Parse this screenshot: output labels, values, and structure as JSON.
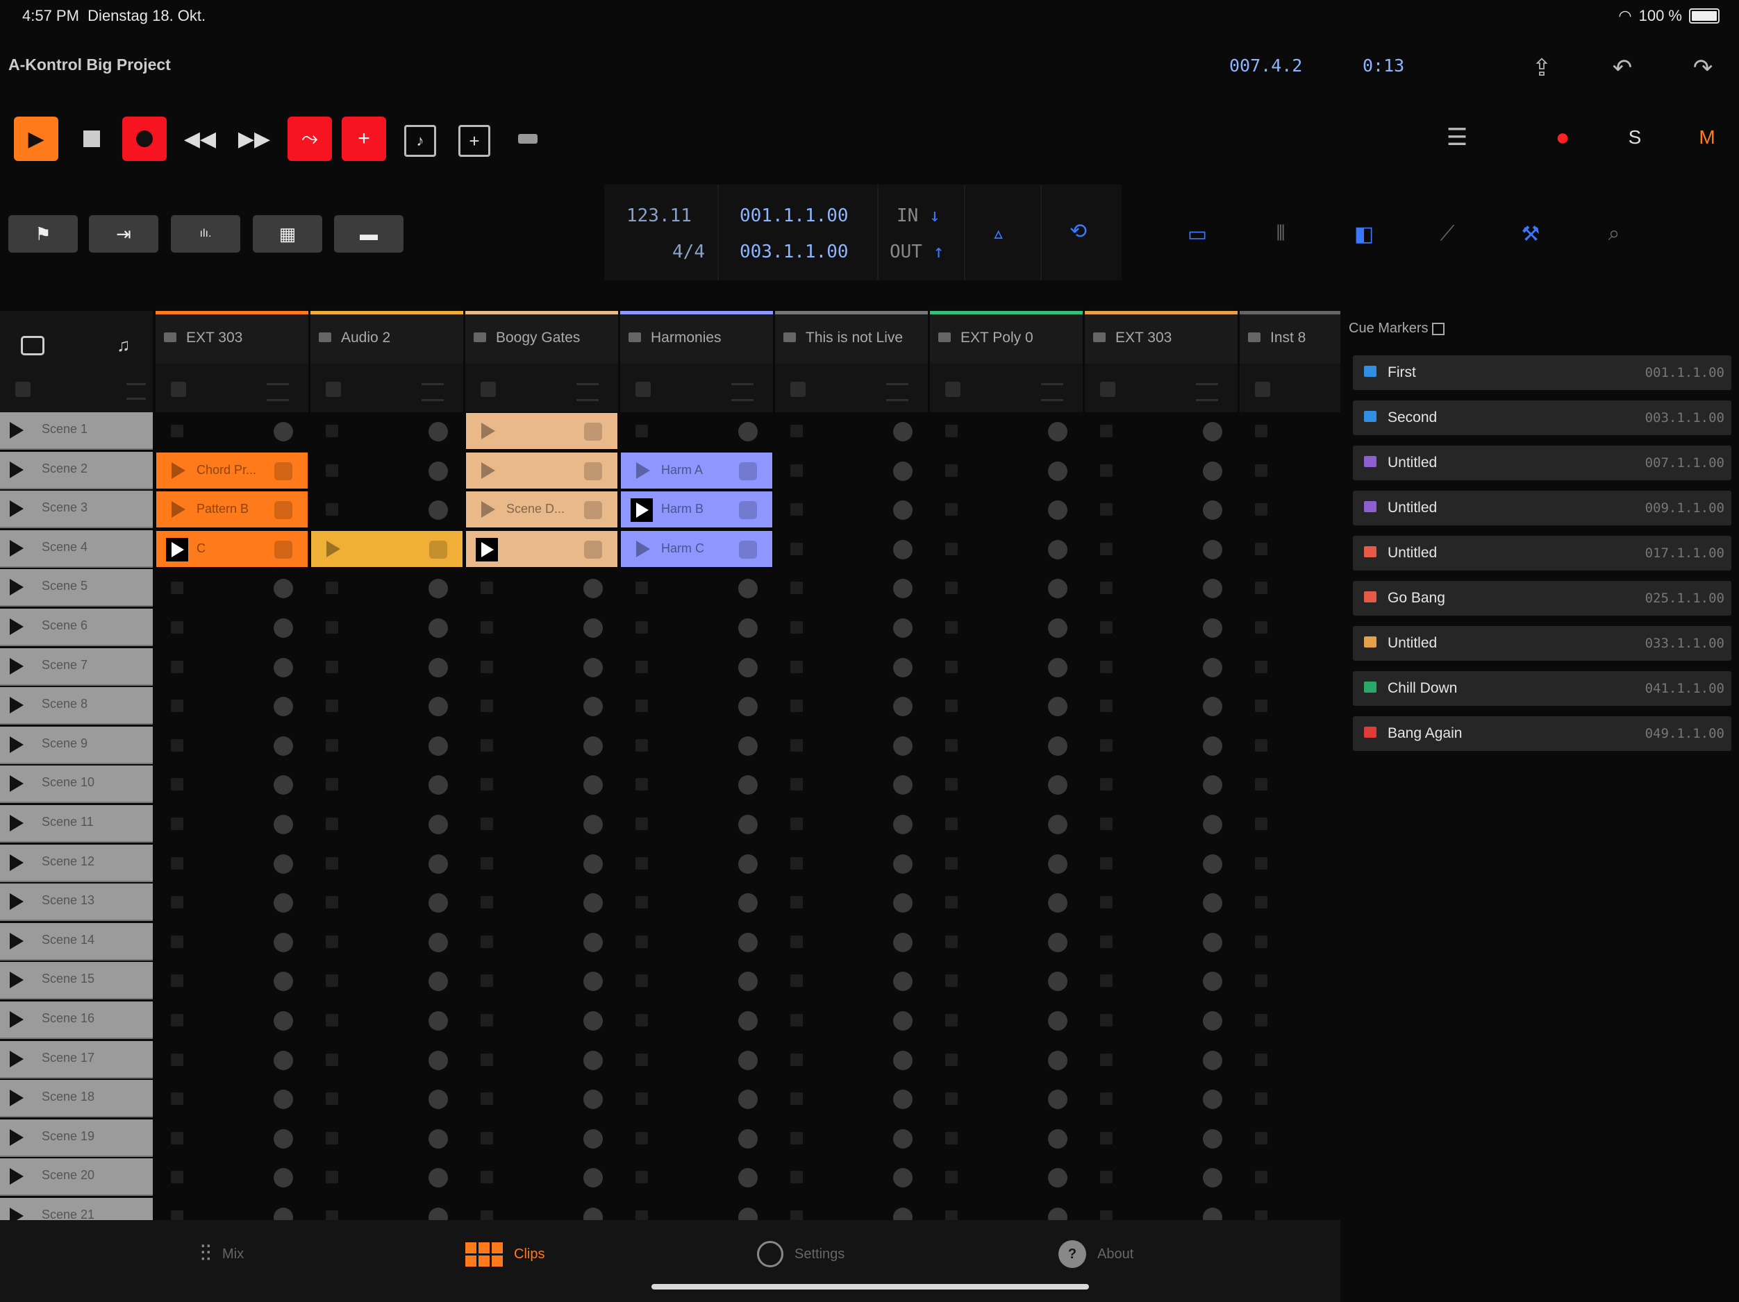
{
  "status": {
    "time": "4:57 PM",
    "date": "Dienstag 18. Okt.",
    "battery": "100 %"
  },
  "project": {
    "title": "A-Kontrol Big Project",
    "position": "007.4.2",
    "clock": "0:13"
  },
  "lcd": {
    "tempo": "123.11",
    "signature": "4/4",
    "loop_start": "001.1.1.00",
    "loop_end": "003.1.1.00",
    "in_label": "IN",
    "out_label": "OUT"
  },
  "tracks": [
    {
      "name": "EXT 303",
      "color": "#ff7a1a"
    },
    {
      "name": "Audio 2",
      "color": "#f0b037"
    },
    {
      "name": "Boogy Gates",
      "color": "#e9b98a"
    },
    {
      "name": "Harmonies",
      "color": "#8d97ff"
    },
    {
      "name": "This is not Live",
      "color": "#777777"
    },
    {
      "name": "EXT Poly 0",
      "color": "#36c07a"
    },
    {
      "name": "EXT 303",
      "color": "#e5a24a"
    },
    {
      "name": "Inst 8",
      "color": "#666666"
    }
  ],
  "scenes": [
    "Scene 1",
    "Scene 2",
    "Scene 3",
    "Scene 4",
    "Scene 5",
    "Scene 6",
    "Scene 7",
    "Scene 8",
    "Scene 9",
    "Scene 10",
    "Scene 11",
    "Scene 12",
    "Scene 13",
    "Scene 14",
    "Scene 15",
    "Scene 16",
    "Scene 17",
    "Scene 18",
    "Scene 19",
    "Scene 20",
    "Scene 21"
  ],
  "clips": [
    {
      "track": 2,
      "scene": 0,
      "name": "",
      "color": "#e9b98a",
      "playing": false
    },
    {
      "track": 0,
      "scene": 1,
      "name": "Chord Pr...",
      "color": "#ff7a1a",
      "playing": false
    },
    {
      "track": 2,
      "scene": 1,
      "name": "",
      "color": "#e9b98a",
      "playing": false
    },
    {
      "track": 3,
      "scene": 1,
      "name": "Harm A",
      "color": "#8d97ff",
      "playing": false
    },
    {
      "track": 0,
      "scene": 2,
      "name": "Pattern B",
      "color": "#ff7a1a",
      "playing": false
    },
    {
      "track": 2,
      "scene": 2,
      "name": "Scene D...",
      "color": "#e9b98a",
      "playing": false
    },
    {
      "track": 3,
      "scene": 2,
      "name": "Harm B",
      "color": "#8d97ff",
      "playing": true
    },
    {
      "track": 0,
      "scene": 3,
      "name": "C",
      "color": "#ff7a1a",
      "playing": true
    },
    {
      "track": 1,
      "scene": 3,
      "name": "",
      "color": "#f0b037",
      "playing": false
    },
    {
      "track": 2,
      "scene": 3,
      "name": "",
      "color": "#e9b98a",
      "playing": true
    },
    {
      "track": 3,
      "scene": 3,
      "name": "Harm C",
      "color": "#8d97ff",
      "playing": false
    }
  ],
  "cue_markers": {
    "title": "Cue Markers",
    "items": [
      {
        "name": "First",
        "pos": "001.1.1.00",
        "color": "#2f8fe0"
      },
      {
        "name": "Second",
        "pos": "003.1.1.00",
        "color": "#2f8fe0"
      },
      {
        "name": "Untitled",
        "pos": "007.1.1.00",
        "color": "#8e5fd0"
      },
      {
        "name": "Untitled",
        "pos": "009.1.1.00",
        "color": "#8e5fd0"
      },
      {
        "name": "Untitled",
        "pos": "017.1.1.00",
        "color": "#e65a4a"
      },
      {
        "name": "Go Bang",
        "pos": "025.1.1.00",
        "color": "#e65a4a"
      },
      {
        "name": "Untitled",
        "pos": "033.1.1.00",
        "color": "#e5a24a"
      },
      {
        "name": "Chill Down",
        "pos": "041.1.1.00",
        "color": "#2aa86a"
      },
      {
        "name": "Bang Again",
        "pos": "049.1.1.00",
        "color": "#e03a3a"
      }
    ]
  },
  "tabs": [
    {
      "label": "Mix",
      "icon": "mixer-icon"
    },
    {
      "label": "Clips",
      "icon": "grid-icon"
    },
    {
      "label": "Settings",
      "icon": "gauge-icon"
    },
    {
      "label": "About",
      "icon": "help-icon"
    }
  ]
}
